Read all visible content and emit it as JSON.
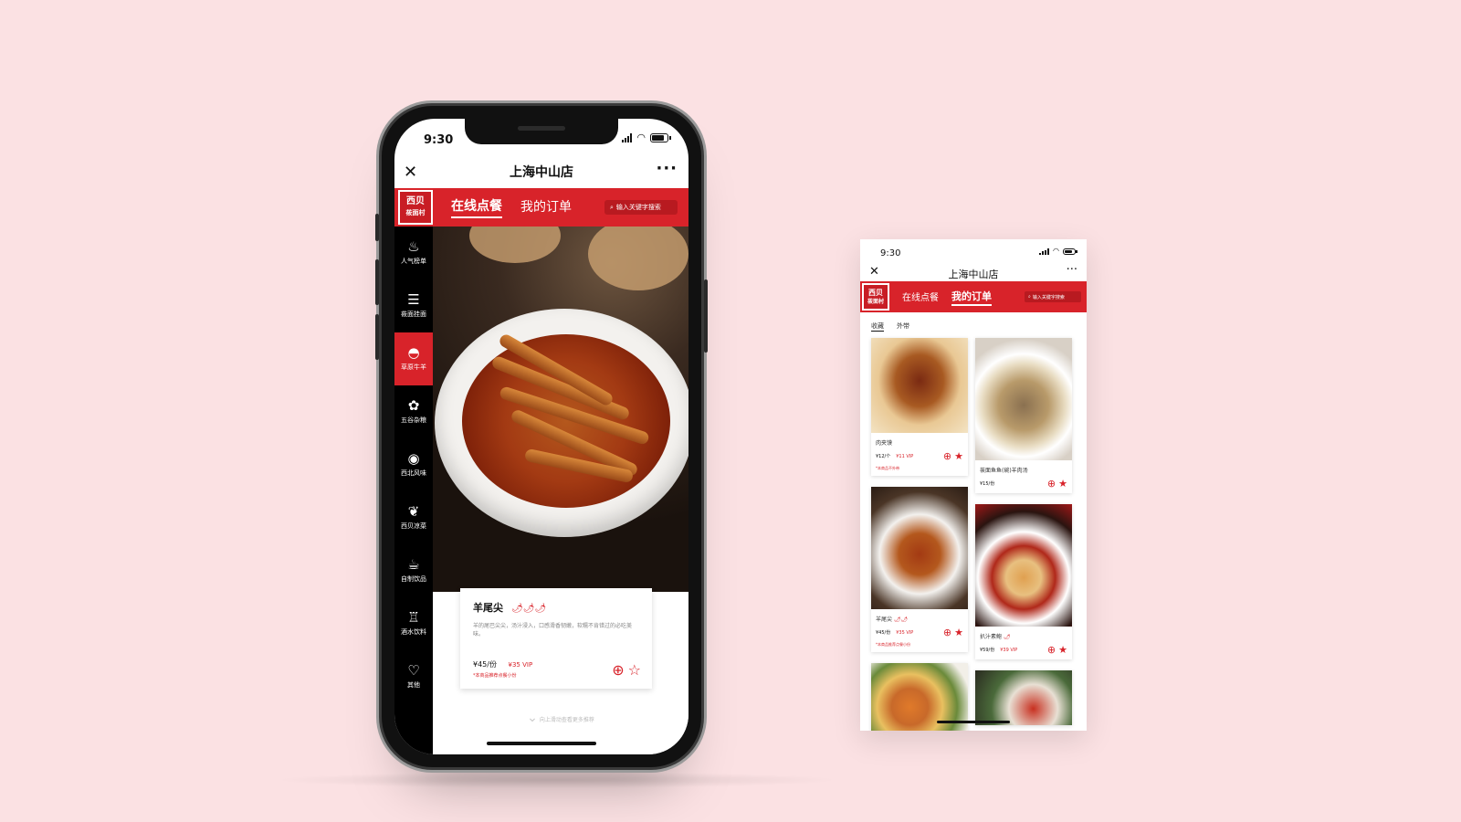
{
  "phone1": {
    "status": {
      "time": "9:30"
    },
    "title": "上海中山店",
    "logo": {
      "line1": "西贝",
      "line2": "莜面村"
    },
    "tabs": [
      {
        "label": "在线点餐"
      },
      {
        "label": "我的订单"
      }
    ],
    "search": {
      "placeholder": "输入关键字搜索"
    },
    "sidebar": [
      {
        "label": "人气榜单",
        "icon": "flame-icon"
      },
      {
        "label": "莜面挂面",
        "icon": "noodle-icon"
      },
      {
        "label": "草原牛羊",
        "icon": "bowl-icon"
      },
      {
        "label": "五谷杂粮",
        "icon": "grain-icon"
      },
      {
        "label": "西北风味",
        "icon": "bun-icon"
      },
      {
        "label": "西贝凉菜",
        "icon": "vegetable-icon"
      },
      {
        "label": "自制饮品",
        "icon": "drink-icon"
      },
      {
        "label": "酒水饮料",
        "icon": "bottle-icon"
      },
      {
        "label": "其他",
        "icon": "heart-icon"
      }
    ],
    "featured": {
      "name": "羊尾尖",
      "desc": "羊的尾巴尖尖，汤汁浸入，口感滑香韧嫩，软糯不肯错过的必吃美味。",
      "price": "¥45/份",
      "vip_price": "¥35 VIP",
      "note": "*本商品推荐点餐小份"
    },
    "bottom_hint": "向上滑动查看更多推荐"
  },
  "phone2": {
    "status": {
      "time": "9:30"
    },
    "title": "上海中山店",
    "logo": {
      "line1": "西贝",
      "line2": "莜面村"
    },
    "tabs": [
      {
        "label": "在线点餐"
      },
      {
        "label": "我的订单"
      }
    ],
    "search": {
      "placeholder": "输入关键字搜索"
    },
    "subtabs": [
      {
        "label": "收藏"
      },
      {
        "label": "外带"
      }
    ],
    "products": [
      {
        "name": "肉夹馍",
        "price": "¥12/个",
        "vip": "¥11 VIP",
        "note": "*本商品不外带"
      },
      {
        "name": "莜面鱼鱼(碗)羊肉汤",
        "price": "¥15/份",
        "vip": "",
        "note": ""
      },
      {
        "name": "羊尾尖",
        "price": "¥45/份",
        "vip": "¥35 VIP",
        "note": "*本商品推荐点餐小份"
      },
      {
        "name": "扒汁素鲍",
        "price": "¥59/份",
        "vip": "¥39 VIP",
        "note": ""
      }
    ]
  }
}
